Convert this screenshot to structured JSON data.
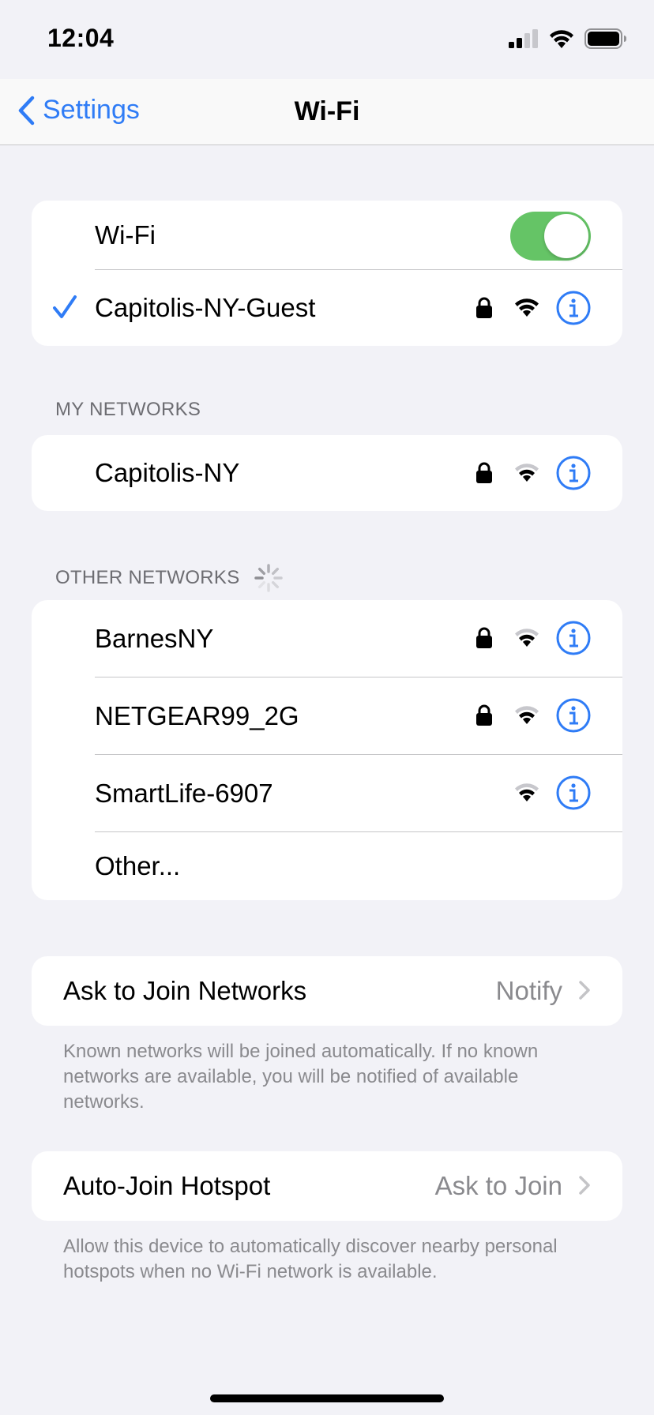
{
  "status_bar": {
    "time": "12:04"
  },
  "nav": {
    "back_label": "Settings",
    "title": "Wi-Fi"
  },
  "wifi_toggle": {
    "label": "Wi-Fi",
    "on": true,
    "color": "#65c466"
  },
  "connected": {
    "name": "Capitolis-NY-Guest",
    "secured": true
  },
  "my_networks": {
    "header": "MY NETWORKS",
    "items": [
      {
        "name": "Capitolis-NY",
        "secured": true
      }
    ]
  },
  "other_networks": {
    "header": "OTHER NETWORKS",
    "items": [
      {
        "name": "BarnesNY",
        "secured": true
      },
      {
        "name": "NETGEAR99_2G",
        "secured": true
      },
      {
        "name": "SmartLife-6907",
        "secured": false
      }
    ],
    "other_label": "Other..."
  },
  "ask_to_join": {
    "label": "Ask to Join Networks",
    "value": "Notify",
    "note": "Known networks will be joined automatically. If no known networks are available, you will be notified of available networks."
  },
  "auto_join": {
    "label": "Auto-Join Hotspot",
    "value": "Ask to Join",
    "note": "Allow this device to automatically discover nearby personal hotspots when no Wi-Fi network is available."
  },
  "colors": {
    "accent": "#2f7cf6",
    "background": "#f2f2f7",
    "secondary_text": "#8a8a8e"
  }
}
